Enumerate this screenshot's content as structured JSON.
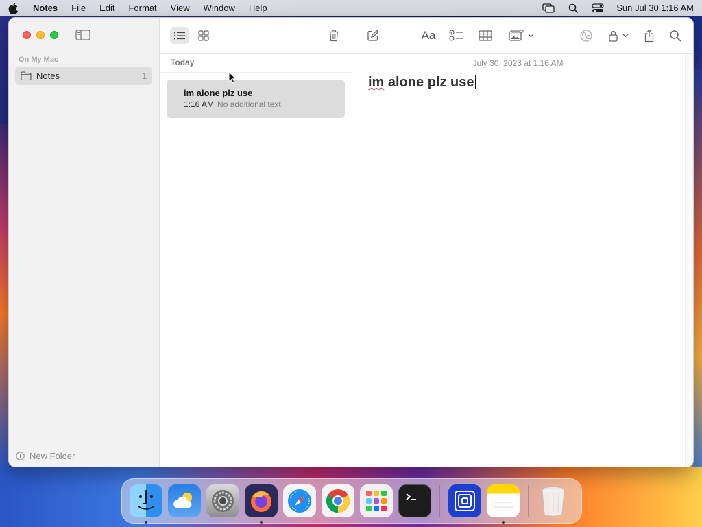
{
  "menubar": {
    "apple_icon": "apple-icon",
    "app_name": "Notes",
    "items": [
      "File",
      "Edit",
      "Format",
      "View",
      "Window",
      "Help"
    ],
    "clock": "Sun Jul 30  1:16 AM"
  },
  "sidebar": {
    "section_label": "On My Mac",
    "folders": [
      {
        "label": "Notes",
        "count": "1"
      }
    ],
    "new_folder_label": "New Folder"
  },
  "notelist": {
    "group_label": "Today",
    "notes": [
      {
        "title": "im alone plz use",
        "time": "1:16 AM",
        "preview": "No additional text"
      }
    ]
  },
  "editor": {
    "timestamp": "July 30, 2023 at 1:16 AM",
    "text_word1": "im",
    "text_rest": " alone plz use",
    "format_label": "Aa"
  },
  "dock": {
    "apps": [
      "Finder",
      "Weather",
      "System Settings",
      "Firefox",
      "Safari",
      "Chrome",
      "Launchpad",
      "Terminal",
      "Simulator",
      "Notes",
      "Trash"
    ]
  },
  "colors": {
    "close": "#fe5f57",
    "minimize": "#febc2e",
    "maximize": "#28c840",
    "selection": "#dcdcdc"
  }
}
